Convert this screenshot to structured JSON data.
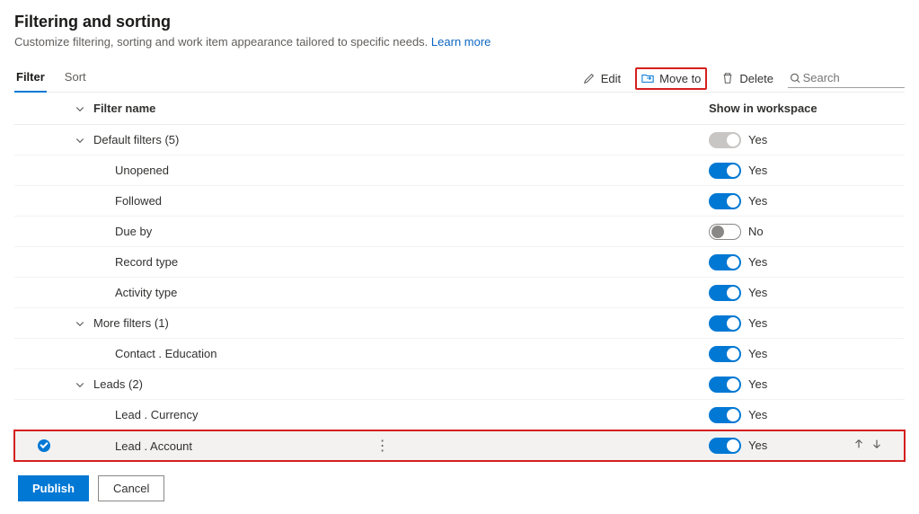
{
  "header": {
    "title": "Filtering and sorting",
    "subtitle": "Customize filtering, sorting and work item appearance tailored to specific needs.",
    "learn_more": "Learn more"
  },
  "tabs": {
    "filter": "Filter",
    "sort": "Sort"
  },
  "toolbar": {
    "edit": "Edit",
    "move_to": "Move to",
    "delete": "Delete",
    "search_placeholder": "Search"
  },
  "columns": {
    "name": "Filter name",
    "show": "Show in workspace"
  },
  "toggle_labels": {
    "yes": "Yes",
    "no": "No"
  },
  "groups": [
    {
      "name": "Default filters (5)",
      "expanded": true,
      "show": "yes",
      "toggle_state": "disabled",
      "children": [
        {
          "name": "Unopened",
          "show": "yes",
          "toggle_state": "on"
        },
        {
          "name": "Followed",
          "show": "yes",
          "toggle_state": "on"
        },
        {
          "name": "Due by",
          "show": "no",
          "toggle_state": "off"
        },
        {
          "name": "Record type",
          "show": "yes",
          "toggle_state": "on"
        },
        {
          "name": "Activity type",
          "show": "yes",
          "toggle_state": "on"
        }
      ]
    },
    {
      "name": "More filters (1)",
      "expanded": true,
      "show": "yes",
      "toggle_state": "on",
      "children": [
        {
          "name": "Contact . Education",
          "show": "yes",
          "toggle_state": "on"
        }
      ]
    },
    {
      "name": "Leads (2)",
      "expanded": true,
      "show": "yes",
      "toggle_state": "on",
      "children": [
        {
          "name": "Lead . Currency",
          "show": "yes",
          "toggle_state": "on"
        },
        {
          "name": "Lead . Account",
          "show": "yes",
          "toggle_state": "on",
          "selected": true
        }
      ]
    }
  ],
  "footer": {
    "publish": "Publish",
    "cancel": "Cancel"
  }
}
